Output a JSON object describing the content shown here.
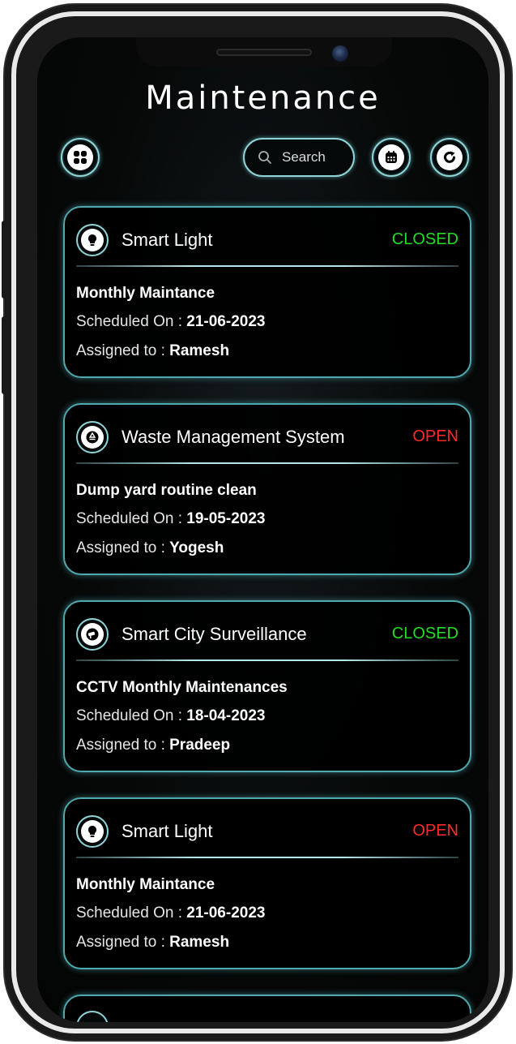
{
  "header": {
    "title": "Maintenance"
  },
  "toolbar": {
    "search_placeholder": "Search"
  },
  "colors": {
    "closed": "#22dd22",
    "open": "#ff2a2a",
    "accent": "#8fd4d6"
  },
  "icons": {
    "menu": "grid-icon",
    "calendar": "calendar-icon",
    "refresh": "refresh-icon",
    "search": "search-icon"
  },
  "labels": {
    "scheduled_on": "Scheduled On : ",
    "assigned_to": "Assigned to : "
  },
  "cards": [
    {
      "icon": "lightbulb-icon",
      "title": "Smart Light",
      "status": "CLOSED",
      "task": "Monthly Maintance",
      "scheduled": "21-06-2023",
      "assignee": "Ramesh"
    },
    {
      "icon": "recycle-icon",
      "title": "Waste Management System",
      "status": "OPEN",
      "task": "Dump yard routine clean",
      "scheduled": "19-05-2023",
      "assignee": "Yogesh"
    },
    {
      "icon": "cctv-icon",
      "title": "Smart City Surveillance",
      "status": "CLOSED",
      "task": "CCTV Monthly Maintenances",
      "scheduled": "18-04-2023",
      "assignee": "Pradeep"
    },
    {
      "icon": "lightbulb-icon",
      "title": "Smart Light",
      "status": "OPEN",
      "task": "Monthly Maintance",
      "scheduled": "21-06-2023",
      "assignee": "Ramesh"
    }
  ]
}
